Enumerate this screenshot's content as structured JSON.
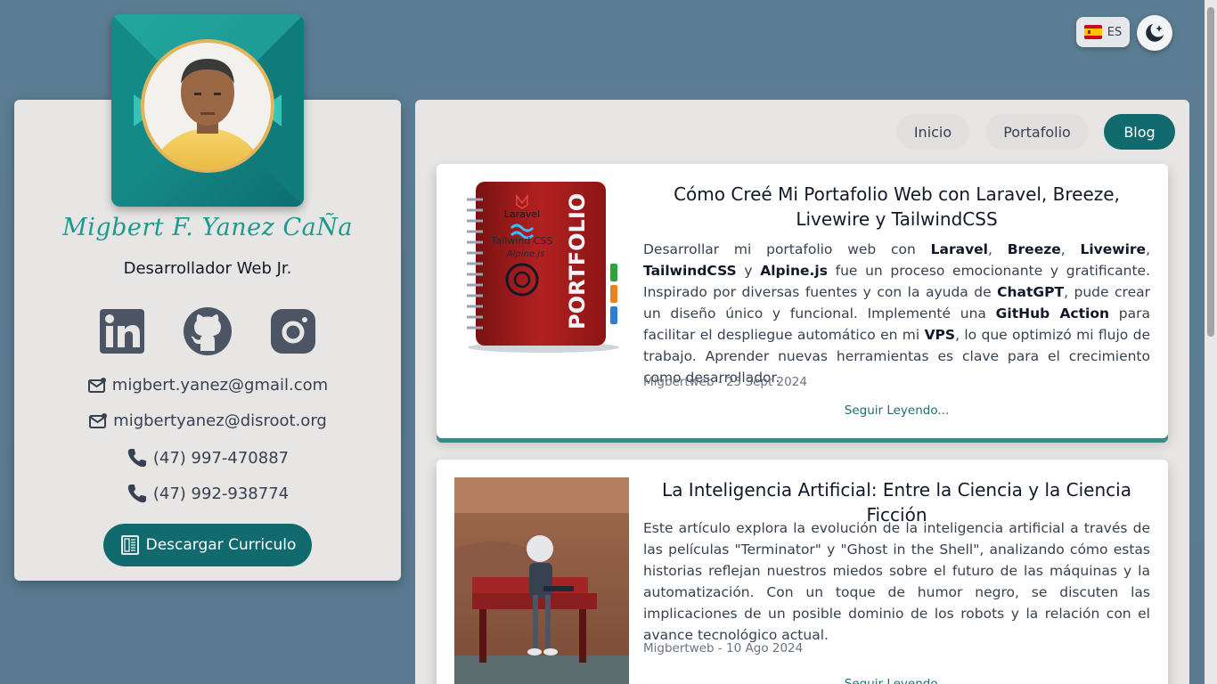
{
  "top": {
    "language": "ES",
    "flag": "spain-flag-icon",
    "theme_icon": "moon-stars-icon"
  },
  "profile": {
    "name": "Migbert F. Yanez CaÑa",
    "role": "Desarrollador Web Jr.",
    "social": [
      "linkedin-icon",
      "github-icon",
      "instagram-icon"
    ],
    "emails": [
      "migbert.yanez@gmail.com",
      "migbertyanez@disroot.org"
    ],
    "phones": [
      "(47) 997-470887",
      "(47) 992-938774"
    ],
    "cv_button": "Descargar Curriculo"
  },
  "nav": {
    "items": [
      "Inicio",
      "Portafolio",
      "Blog"
    ],
    "active": "Blog"
  },
  "posts": [
    {
      "title": "Cómo Creé Mi Portafolio Web con Laravel, Breeze, Livewire y TailwindCSS",
      "segments": [
        {
          "t": "Desarrollar mi portafolio web con ",
          "b": false
        },
        {
          "t": "Laravel",
          "b": true
        },
        {
          "t": ", ",
          "b": false
        },
        {
          "t": "Breeze",
          "b": true
        },
        {
          "t": ", ",
          "b": false
        },
        {
          "t": "Livewire",
          "b": true
        },
        {
          "t": ", ",
          "b": false
        },
        {
          "t": "TailwindCSS",
          "b": true
        },
        {
          "t": " y ",
          "b": false
        },
        {
          "t": "Alpine.js",
          "b": true
        },
        {
          "t": " fue un proceso emocionante y gratificante. Inspirado por diversas fuentes y con la ayuda de ",
          "b": false
        },
        {
          "t": "ChatGPT",
          "b": true
        },
        {
          "t": ", pude crear un diseño único y funcional. Implementé una ",
          "b": false
        },
        {
          "t": "GitHub Action",
          "b": true
        },
        {
          "t": " para facilitar el despliegue automático en mi ",
          "b": false
        },
        {
          "t": "VPS",
          "b": true
        },
        {
          "t": ", lo que optimizó mi flujo de trabajo. Aprender nuevas herramientas es clave para el crecimiento como desarrollador.",
          "b": false
        }
      ],
      "meta": "Migbertweb - 25 Sept 2024",
      "more": "Seguir Leyendo...",
      "image_labels": {
        "laravel": "Laravel",
        "tailwind": "Tailwind CSS",
        "alpine": "Alpine.js",
        "portfolio": "PORTFOLIO"
      }
    },
    {
      "title": "La Inteligencia Artificial: Entre la Ciencia y la Ciencia Ficción",
      "segments": [
        {
          "t": "Este artículo explora la evolución de la inteligencia artificial a través de las películas \"Terminator\" y \"Ghost in the Shell\", analizando cómo estas historias reflejan nuestros miedos sobre el futuro de las máquinas y la automatización. Con un toque de humor negro, se discuten las implicaciones de un posible dominio de los robots y la relación con el avance tecnológico actual.",
          "b": false
        }
      ],
      "meta": "Migbertweb - 10 Ago 2024",
      "more": "Seguir Leyendo..."
    }
  ]
}
